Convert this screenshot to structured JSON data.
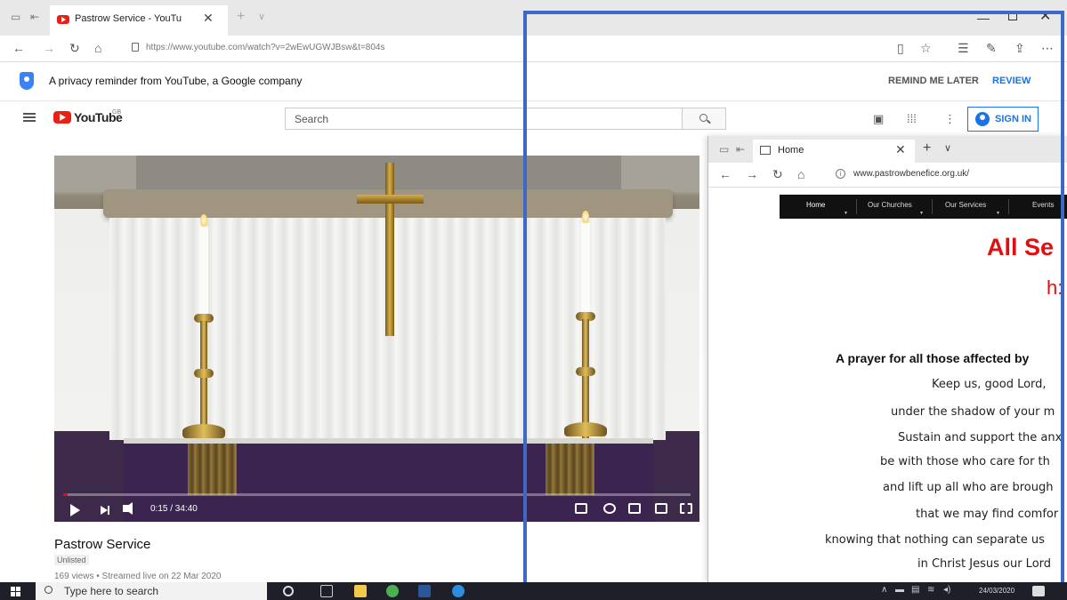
{
  "browser": {
    "tab_title": "Pastrow Service - YouTu",
    "url": "https://www.youtube.com/watch?v=2wEwUGWJBsw&t=804s"
  },
  "privacy_banner": {
    "text": "A privacy reminder from YouTube, a Google company",
    "remind_label": "REMIND ME LATER",
    "review_label": "REVIEW"
  },
  "youtube": {
    "logo_text": "YouTube",
    "region": "GB",
    "search_placeholder": "Search",
    "signin_label": "SIGN IN"
  },
  "video": {
    "time": "0:15 / 34:40",
    "progress_percent": 0.72,
    "title": "Pastrow Service",
    "visibility": "Unlisted",
    "meta": "169 views • Streamed live on 22 Mar 2020"
  },
  "second_window": {
    "tab_title": "Home",
    "url": "www.pastrowbenefice.org.uk/",
    "site_nav": [
      "Home",
      "Our Churches",
      "Our Services",
      "Events"
    ],
    "heading": "All Se",
    "subheading": "h:",
    "prayer_title": "A prayer for all those affected by",
    "prayer_lines": [
      "Keep us, good Lord,",
      "under the shadow of your m",
      "Sustain and support the anx",
      "be with those who care for th",
      "and lift up all who are brough",
      "that we may find comfor",
      "knowing that nothing can separate us",
      "in Christ Jesus our Lord"
    ]
  },
  "taskbar": {
    "search_placeholder": "Type here to search",
    "date": "24/03/2020"
  },
  "colors": {
    "youtube_red": "#e62117",
    "link_blue": "#1a73e8",
    "heading_red": "#e01010",
    "annotation_blue": "#3f68c4"
  }
}
